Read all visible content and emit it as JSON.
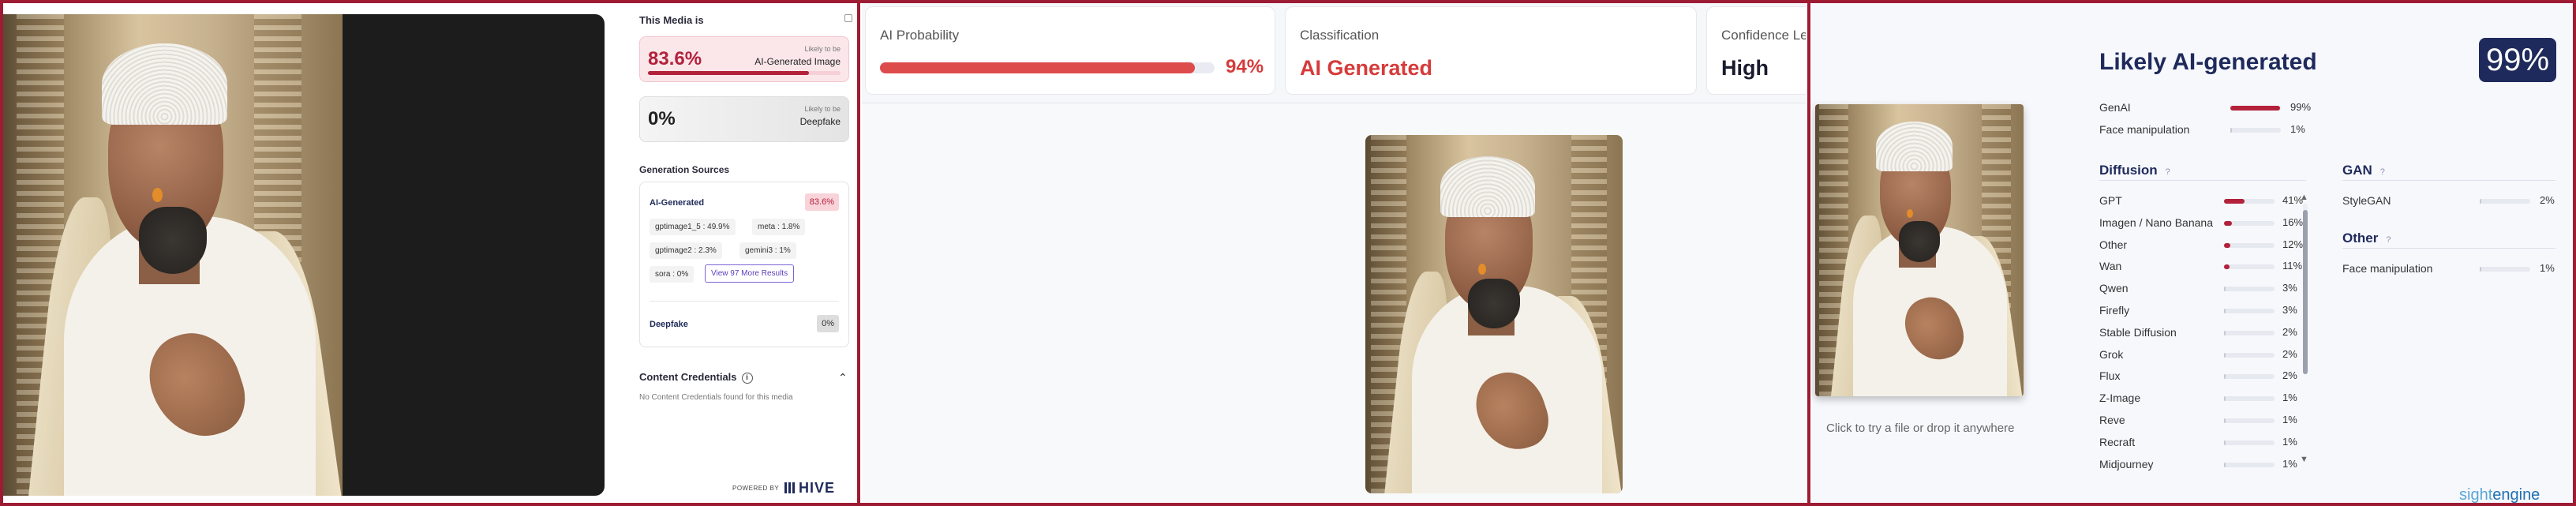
{
  "hive": {
    "title": "This Media is",
    "ai_card": {
      "percent": "83.6%",
      "caption_small": "Likely to be",
      "caption": "AI-Generated Image",
      "fill": 0.836
    },
    "deepfake_card": {
      "percent": "0%",
      "caption_small": "Likely to be",
      "caption": "Deepfake"
    },
    "sources_title": "Generation Sources",
    "ai_generated_label": "AI-Generated",
    "ai_generated_pct": "83.6%",
    "chips": [
      "gptimage1_5 : 49.9%",
      "meta : 1.8%",
      "gptimage2 : 2.3%",
      "gemini3 : 1%",
      "sora : 0%"
    ],
    "more_button": "View 97 More Results",
    "deepfake_label": "Deepfake",
    "deepfake_pct": "0%",
    "credentials_title": "Content Credentials",
    "credentials_info": "i",
    "credentials_chevron": "⌃",
    "credentials_msg": "No Content Credentials found for this media",
    "powered": "POWERED BY",
    "logo": "HIVE"
  },
  "panel2": {
    "cards": [
      {
        "label": "AI Probability",
        "percent": "94%",
        "fill": 0.94
      },
      {
        "label": "Classification",
        "value": "AI Generated"
      },
      {
        "label": "Confidence Level",
        "value": "High"
      }
    ]
  },
  "sightengine": {
    "title": "Likely AI-generated",
    "badge": "99%",
    "hint": "Click to try a file or drop it anywhere",
    "summary": [
      {
        "name": "GenAI",
        "pct": "99%",
        "value": 0.99
      },
      {
        "name": "Face manipulation",
        "pct": "1%",
        "value": 0.01
      }
    ],
    "diffusion": {
      "title": "Diffusion",
      "help": "?",
      "items": [
        {
          "name": "GPT",
          "pct": "41%",
          "value": 0.41
        },
        {
          "name": "Imagen / Nano Banana",
          "pct": "16%",
          "value": 0.16
        },
        {
          "name": "Other",
          "pct": "12%",
          "value": 0.12
        },
        {
          "name": "Wan",
          "pct": "11%",
          "value": 0.11
        },
        {
          "name": "Qwen",
          "pct": "3%",
          "value": 0.03
        },
        {
          "name": "Firefly",
          "pct": "3%",
          "value": 0.03
        },
        {
          "name": "Stable Diffusion",
          "pct": "2%",
          "value": 0.02
        },
        {
          "name": "Grok",
          "pct": "2%",
          "value": 0.02
        },
        {
          "name": "Flux",
          "pct": "2%",
          "value": 0.02
        },
        {
          "name": "Z-Image",
          "pct": "1%",
          "value": 0.01
        },
        {
          "name": "Reve",
          "pct": "1%",
          "value": 0.01
        },
        {
          "name": "Recraft",
          "pct": "1%",
          "value": 0.01
        },
        {
          "name": "Midjourney",
          "pct": "1%",
          "value": 0.01
        }
      ]
    },
    "gan": {
      "title": "GAN",
      "help": "?",
      "items": [
        {
          "name": "StyleGAN",
          "pct": "2%",
          "value": 0.02
        }
      ]
    },
    "other": {
      "title": "Other",
      "help": "?",
      "items": [
        {
          "name": "Face manipulation",
          "pct": "1%",
          "value": 0.01
        }
      ]
    },
    "scroll_up": "▲",
    "scroll_down": "▼",
    "logo_a": "sight",
    "logo_b": "engine"
  },
  "colors": {
    "frame": "#9e1c33",
    "ai_red": "#b3213b",
    "navy": "#1f2a5c",
    "bar_red": "#de4b4b"
  }
}
